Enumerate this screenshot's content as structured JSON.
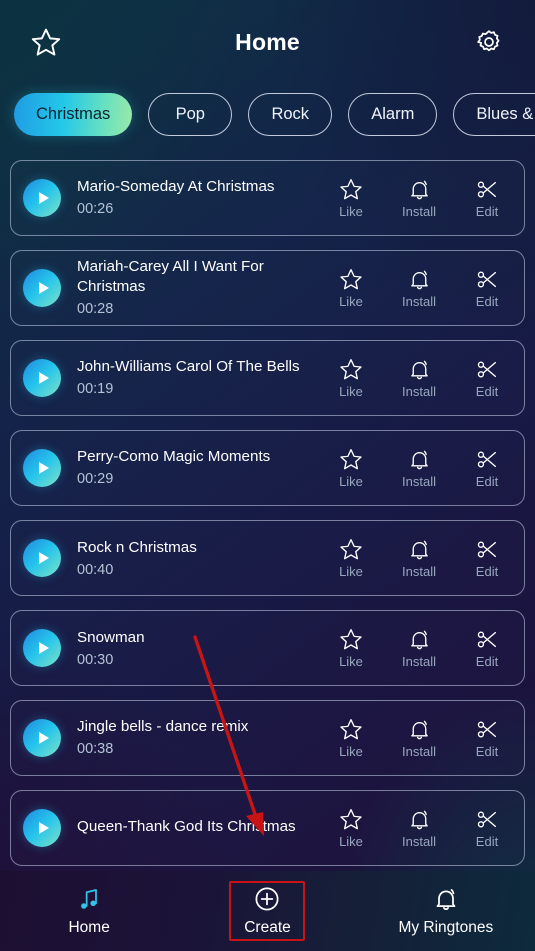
{
  "header": {
    "title": "Home",
    "favorites_icon": "star-icon",
    "settings_icon": "gear-icon"
  },
  "categories": [
    {
      "label": "Christmas",
      "active": true
    },
    {
      "label": "Pop",
      "active": false
    },
    {
      "label": "Rock",
      "active": false
    },
    {
      "label": "Alarm",
      "active": false
    },
    {
      "label": "Blues &",
      "active": false
    }
  ],
  "actions": {
    "like_label": "Like",
    "install_label": "Install",
    "edit_label": "Edit",
    "like_icon": "star-icon",
    "install_icon": "bell-icon",
    "edit_icon": "scissors-icon",
    "play_icon": "play-icon"
  },
  "songs": [
    {
      "title": "Mario-Someday At Christmas",
      "duration": "00:26"
    },
    {
      "title": "Mariah-Carey All I Want For Christmas",
      "duration": "00:28"
    },
    {
      "title": "John-Williams Carol Of The Bells",
      "duration": "00:19"
    },
    {
      "title": "Perry-Como Magic Moments",
      "duration": "00:29"
    },
    {
      "title": "Rock n Christmas",
      "duration": "00:40"
    },
    {
      "title": "Snowman",
      "duration": "00:30"
    },
    {
      "title": "Jingle bells - dance remix",
      "duration": "00:38"
    },
    {
      "title": "Queen-Thank God Its Christmas",
      "duration": ""
    }
  ],
  "bottom_nav": [
    {
      "label": "Home",
      "icon": "music-note-icon",
      "active": true
    },
    {
      "label": "Create",
      "icon": "plus-circle-icon",
      "active": false
    },
    {
      "label": "My Ringtones",
      "icon": "bell-icon",
      "active": false
    }
  ],
  "annotation": {
    "highlight_color": "#c81414",
    "arrow_color": "#c81414",
    "target": "Create"
  },
  "colors": {
    "accent_cyan": "#24c8e8",
    "accent_green": "#9be8a8",
    "accent_blue": "#2089e0",
    "muted_text": "#98a7be",
    "time_text": "#b4c3d6"
  }
}
